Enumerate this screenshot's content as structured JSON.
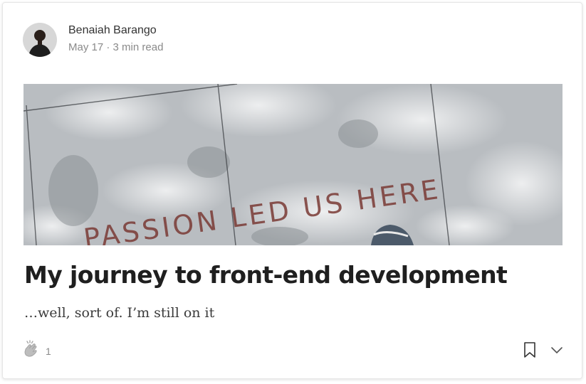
{
  "author": {
    "name": "Benaiah Barango"
  },
  "meta": {
    "date": "May 17",
    "separator": "·",
    "read_time": "3 min read"
  },
  "hero_image": {
    "alt_text_visible": "PASSION LED US HERE"
  },
  "post": {
    "title": "My journey to front-end development",
    "subtitle": "…well, sort of. I’m still on it"
  },
  "actions": {
    "clap_count": "1",
    "clap_icon": "clap-icon",
    "bookmark_icon": "bookmark-icon",
    "more_icon": "chevron-down-icon"
  },
  "colors": {
    "text_primary": "#1f1f1f",
    "text_muted": "#8a8a8a",
    "hero_lettering": "#7a3a35",
    "pavement": "#b8bcc0"
  }
}
